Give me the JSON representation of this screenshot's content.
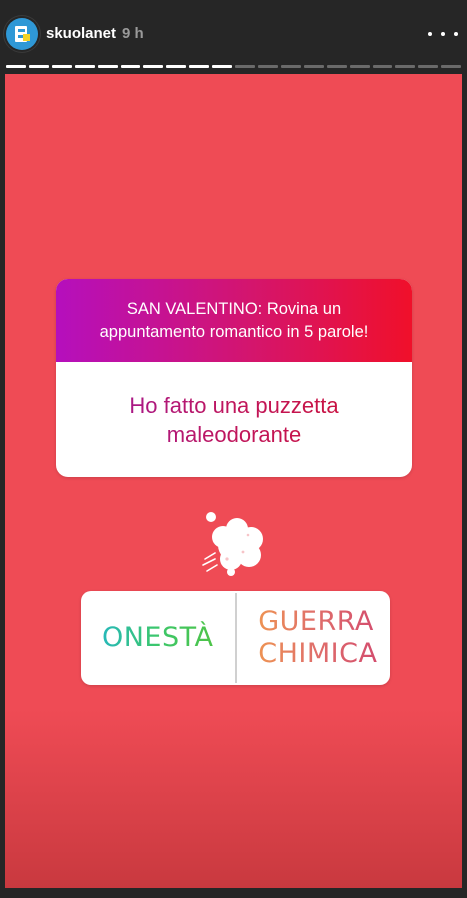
{
  "header": {
    "username": "skuolanet",
    "time": "9 h",
    "progress_total": 20,
    "progress_done": 10,
    "avatar_color": "#2f98d6",
    "menu_icon": "more-horizontal-icon"
  },
  "question_sticker": {
    "question": "SAN VALENTINO: Rovina un appuntamento romantico in 5 parole!",
    "answer": "Ho fatto una puzzetta maleodorante"
  },
  "sticker_icon": "fart-cloud-icon",
  "poll": {
    "option_1": "ONESTÀ",
    "option_2": "GUERRA CHIMICA"
  },
  "colors": {
    "story_background": "#ef4b55",
    "gradient_start": "#b50fbd",
    "gradient_end": "#f0102a"
  }
}
